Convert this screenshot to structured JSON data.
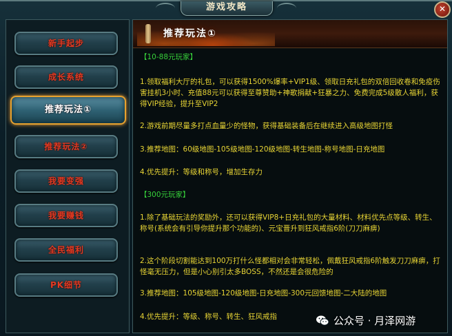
{
  "window": {
    "title": "游戏攻略",
    "close_glyph": "✕"
  },
  "sidebar": {
    "items": [
      {
        "label": "新手起步"
      },
      {
        "label": "成长系统"
      },
      {
        "label": "推荐玩法①"
      },
      {
        "label": "推荐玩法②"
      },
      {
        "label": "我要变强"
      },
      {
        "label": "我要赚钱"
      },
      {
        "label": "全民福利"
      },
      {
        "label": "PK细节"
      }
    ],
    "active_index": 2
  },
  "content": {
    "header_title": "推荐玩法①",
    "section1_title": "【10-88元玩家】",
    "s1_item1": "1.领取福利大厅的礼包，可以获得1500%爆率+VIP1级、领取日充礼包的双倍回收卷和免疫伤害挂机3小时、充值88元可以获得至尊赞助+神歌捐献+狂暴之力、免费完成5级散人福利，获得VIP经验，提升至VIP2",
    "s1_item2": "2.游戏前期尽量多打点血量少的怪物，获得基础装备后在继续进入高级地图打怪",
    "s1_item3": "3.推荐地图：60级地图-105级地图-120级地图-转生地图-称号地图-日充地图",
    "s1_item4": "4.优先提升：等级和称号，增加生存力",
    "section2_title": "【300元玩家】",
    "s2_item1": "1.除了基础玩法的奖励外，还可以获得VIP8+日充礼包的大量材料、材料优先点等级、转生、称号(系统会有引导你提升那个功能的)、元宝晋升到狂风戒指6阶(刀刀麻痹)",
    "s2_item2": "2.这个阶段切割能达到100万打什么怪都相对会非常轻松，佩戴狂风戒指6阶触发刀刀麻痹，打怪毫无压力，但是小心别引太多BOSS，不然还是会很危险的",
    "s2_item3": "3.推荐地图：105级地图-120级地图-日充地图-300元回馈地图-二大陆的地图",
    "s2_item4": "4.优先提升：等级、称号、转生、狂风戒指"
  },
  "watermark": {
    "text": "公众号 · 月泽网游",
    "icon": "wechat-icon"
  },
  "colors": {
    "section_title": "#37d23a",
    "item_text": "#e8d535",
    "nav_text": "#e23a22",
    "active_border": "#e8a22e"
  }
}
